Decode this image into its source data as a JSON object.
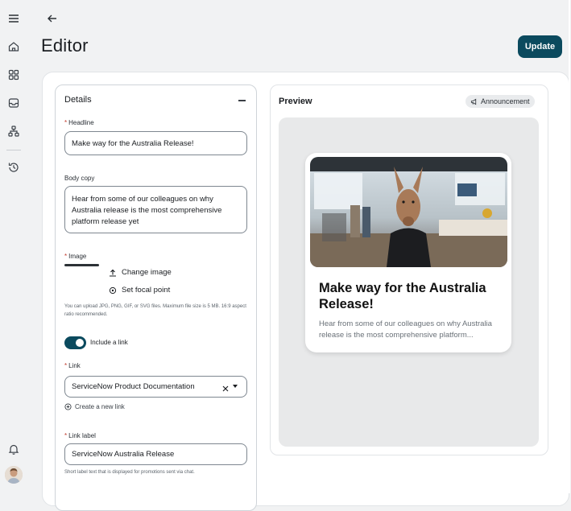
{
  "header": {
    "title": "Editor",
    "update_label": "Update"
  },
  "nav": {
    "icons": [
      "menu-icon",
      "home-icon",
      "dashboard-icon",
      "inbox-icon",
      "org-chart-icon",
      "history-icon",
      "bell-icon"
    ]
  },
  "details": {
    "title": "Details",
    "headline": {
      "label": "Headline",
      "value": "Make way for the Australia Release!"
    },
    "body_copy": {
      "label": "Body copy",
      "value": "Hear from some of our colleagues on why Australia release is the most comprehensive platform release yet"
    },
    "image": {
      "label": "Image",
      "change_label": "Change image",
      "focal_label": "Set focal point",
      "hint": "You can upload JPG, PNG, GIF, or SVG files. Maximum file size is 5 MB. 16:9 aspect ratio recommended."
    },
    "include_link": {
      "label": "Include a link",
      "on": true
    },
    "link": {
      "label": "Link",
      "value": "ServiceNow Product Documentation",
      "create_label": "Create a new link"
    },
    "link_label": {
      "label": "Link label",
      "value": "ServiceNow Australia Release",
      "hint": "Short label text that is displayed for promotions sent via chat."
    }
  },
  "preview": {
    "title": "Preview",
    "badge": "Announcement",
    "card": {
      "headline": "Make way for the Australia Release!",
      "body": "Hear from some of our colleagues on why Australia release is the most comprehensive platform..."
    }
  },
  "colors": {
    "accent": "#0b4a5e",
    "required": "#c0392b",
    "background": "#f1f2f3"
  }
}
